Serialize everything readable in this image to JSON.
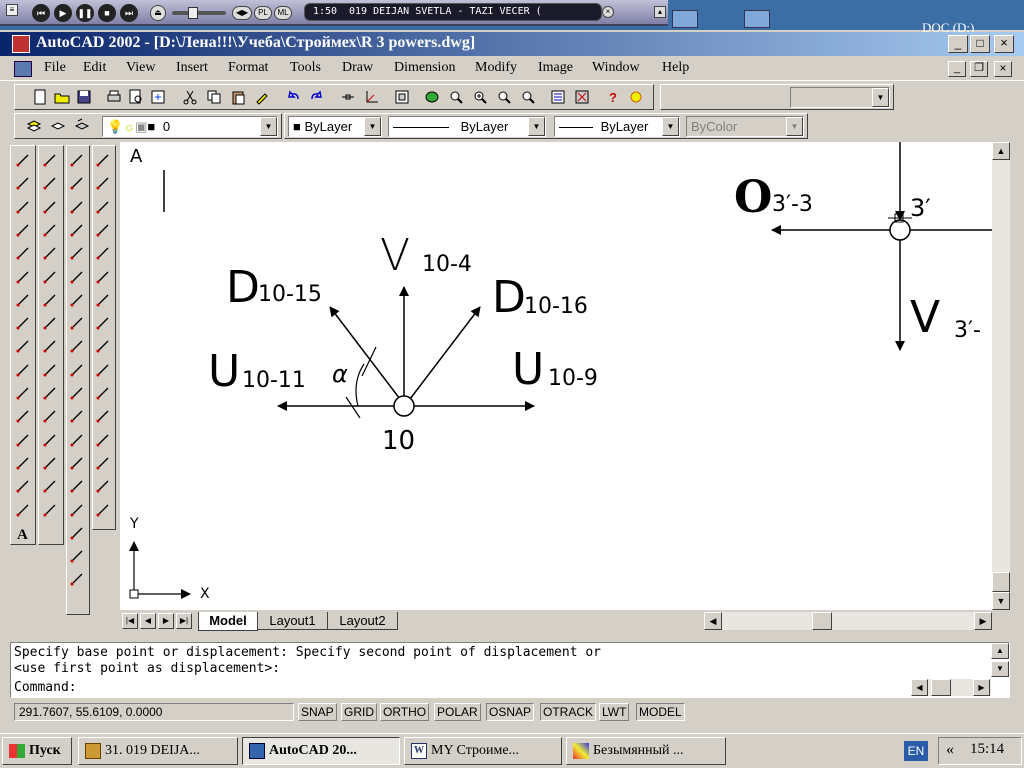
{
  "player": {
    "time": "1:50",
    "track": "019 DEIJAN SVETLA - TAZI VECER (",
    "pl": "PL",
    "ml": "ML"
  },
  "desktop": {
    "corner_label": "DOC (D:)"
  },
  "window": {
    "title": "AutoCAD 2002 - [D:\\Лена!!!\\Учеба\\Строймех\\R 3 powers.dwg]"
  },
  "menu": [
    "File",
    "Edit",
    "View",
    "Insert",
    "Format",
    "Tools",
    "Draw",
    "Dimension",
    "Modify",
    "Image",
    "Window",
    "Help"
  ],
  "layer_toolbar": {
    "layer": "0",
    "color": "ByLayer",
    "linetype": "ByLayer",
    "lineweight": "ByLayer",
    "plotstyle": "ByColor"
  },
  "drawing": {
    "ucs_letter": "A",
    "node_label": "10",
    "forces": {
      "v_top": "V",
      "v_top_sub": "10-4",
      "d_left": "D",
      "d_left_sub": "10-15",
      "d_right": "D",
      "d_right_sub": "10-16",
      "u_left": "U",
      "u_left_sub": "10-11",
      "u_right": "U",
      "u_right_sub": "10-9",
      "angle": "α"
    },
    "right_node": {
      "o": "O",
      "o_sub": "3′-3",
      "label": "3′",
      "v": "V",
      "v_sub": "3′-"
    },
    "axis_x": "X",
    "axis_y": "Y"
  },
  "tabs": [
    "Model",
    "Layout1",
    "Layout2"
  ],
  "active_tab": "Model",
  "command": {
    "line1": "Specify base point or displacement: Specify second point of displacement or",
    "line2": "<use first point as displacement>:",
    "prompt": "Command:"
  },
  "status": {
    "coords": "291.7607, 55.6109, 0.0000",
    "buttons": [
      "SNAP",
      "GRID",
      "ORTHO",
      "POLAR",
      "OSNAP",
      "OTRACK",
      "LWT",
      "MODEL"
    ]
  },
  "taskbar": {
    "start": "Пуск",
    "items": [
      "31. 019 DEIJA...",
      "AutoCAD 20...",
      "MY Строиме...",
      "Безымянный ..."
    ],
    "lang": "EN",
    "arrows": "«",
    "clock": "15:14"
  }
}
